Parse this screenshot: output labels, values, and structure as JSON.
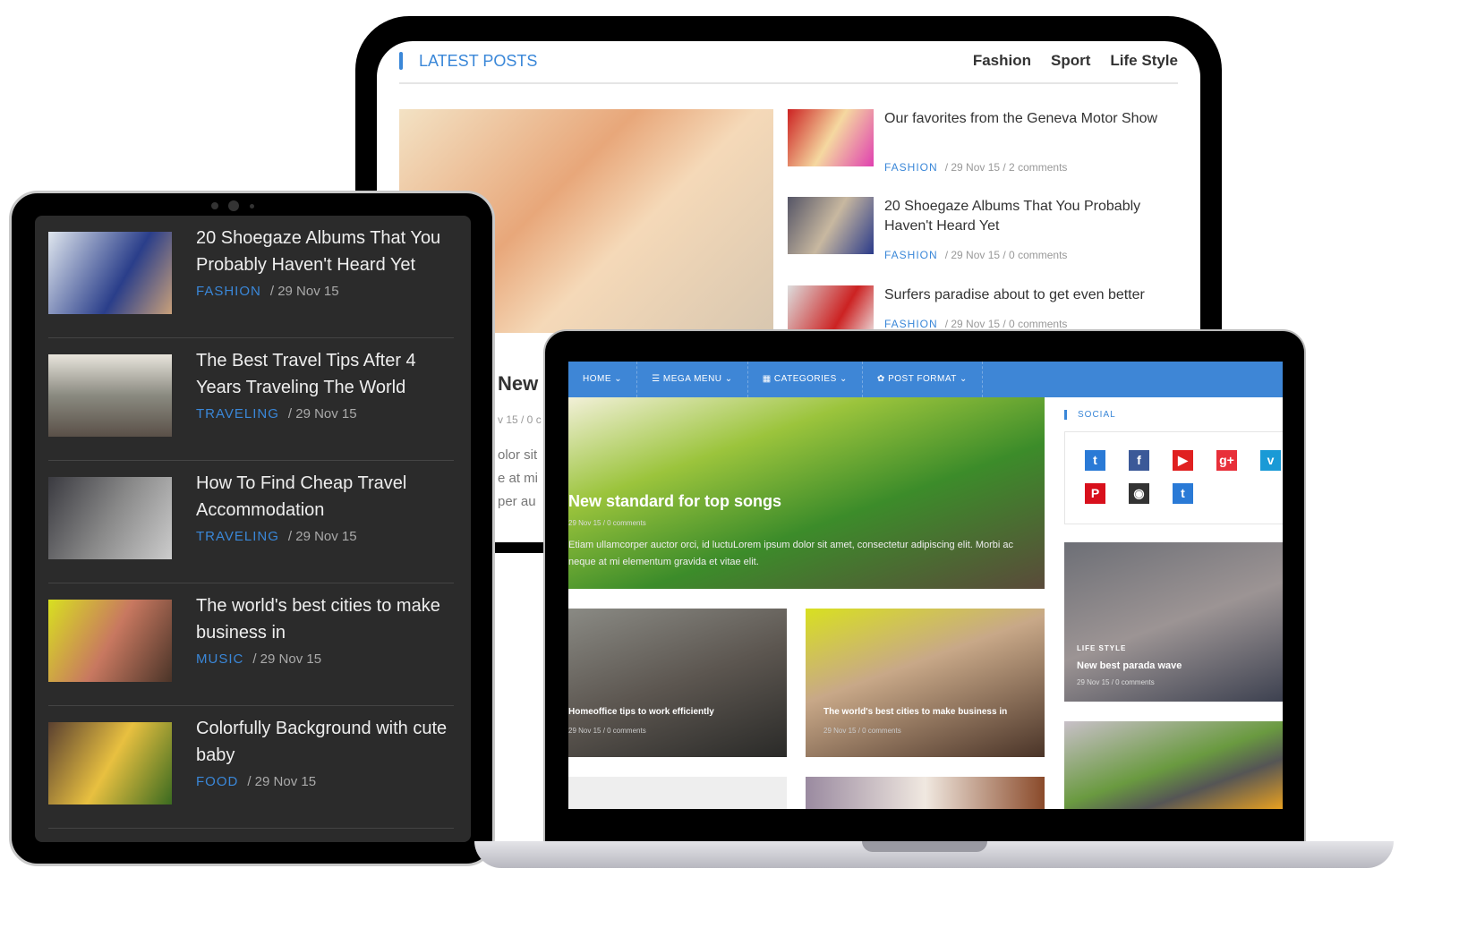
{
  "latest_posts": {
    "title": "LATEST POSTS",
    "tabs": [
      "Fashion",
      "Sport",
      "Life Style"
    ],
    "items": [
      {
        "title": "Our favorites from the Geneva Motor Show",
        "category": "FASHION",
        "meta": "/ 29 Nov 15 / 2 comments"
      },
      {
        "title": "20 Shoegaze Albums That You Probably Haven't Heard Yet",
        "category": "FASHION",
        "meta": "/ 29 Nov 15 / 0 comments"
      },
      {
        "title": "Surfers paradise about to get even better",
        "category": "FASHION",
        "meta": "/ 29 Nov 15 / 0 comments"
      }
    ],
    "partial": {
      "title": "New",
      "meta": "v 15 / 0 c",
      "excerpt": "olor sit e at mi per au"
    }
  },
  "tablet": {
    "items": [
      {
        "title": "20 Shoegaze Albums That You Probably Haven't Heard Yet",
        "category": "FASHION",
        "date": "/ 29 Nov 15"
      },
      {
        "title": "The Best Travel Tips After 4 Years Traveling The World",
        "category": "TRAVELING",
        "date": "/ 29 Nov 15"
      },
      {
        "title": "How To Find Cheap Travel Accommodation",
        "category": "TRAVELING",
        "date": "/ 29 Nov 15"
      },
      {
        "title": "The world's best cities to make business in",
        "category": "MUSIC",
        "date": "/ 29 Nov 15"
      },
      {
        "title": "Colorfully Background with cute baby",
        "category": "FOOD",
        "date": "/ 29 Nov 15"
      }
    ]
  },
  "laptop": {
    "nav": [
      "HOME ⌄",
      "☰  MEGA MENU ⌄",
      "▦  CATEGORIES ⌄",
      "✿  POST FORMAT ⌄"
    ],
    "hero": {
      "title": "New standard for top songs",
      "meta": "29 Nov 15 / 0 comments",
      "excerpt": "Etiam ullamcorper auctor orci, id luctuLorem ipsum dolor sit amet, consectetur adipiscing elit. Morbi ac neque at mi elementum gravida et vitae elit."
    },
    "cards": [
      {
        "title": "Homeoffice tips to work efficiently",
        "meta": "29 Nov 15 / 0 comments"
      },
      {
        "title": "The world's best cities to make business in",
        "meta": "29 Nov 15 / 0 comments"
      }
    ],
    "social": {
      "title": "SOCIAL",
      "icons": [
        {
          "name": "twitter",
          "glyph": "t",
          "color": "#2a7ad6"
        },
        {
          "name": "facebook",
          "glyph": "f",
          "color": "#3b5998"
        },
        {
          "name": "youtube",
          "glyph": "▶",
          "color": "#e02020"
        },
        {
          "name": "google-plus",
          "glyph": "g+",
          "color": "#e8303a"
        },
        {
          "name": "vimeo",
          "glyph": "v",
          "color": "#1a9ad6"
        },
        {
          "name": "pinterest",
          "glyph": "P",
          "color": "#d8101c"
        },
        {
          "name": "github",
          "glyph": "◉",
          "color": "#333333"
        },
        {
          "name": "twitter",
          "glyph": "t",
          "color": "#2a7ad6"
        }
      ]
    },
    "side_post": {
      "category": "LIFE STYLE",
      "title": "New best parada wave",
      "meta": "29 Nov 15 / 0 comments"
    }
  },
  "accent": "#3a87d8"
}
